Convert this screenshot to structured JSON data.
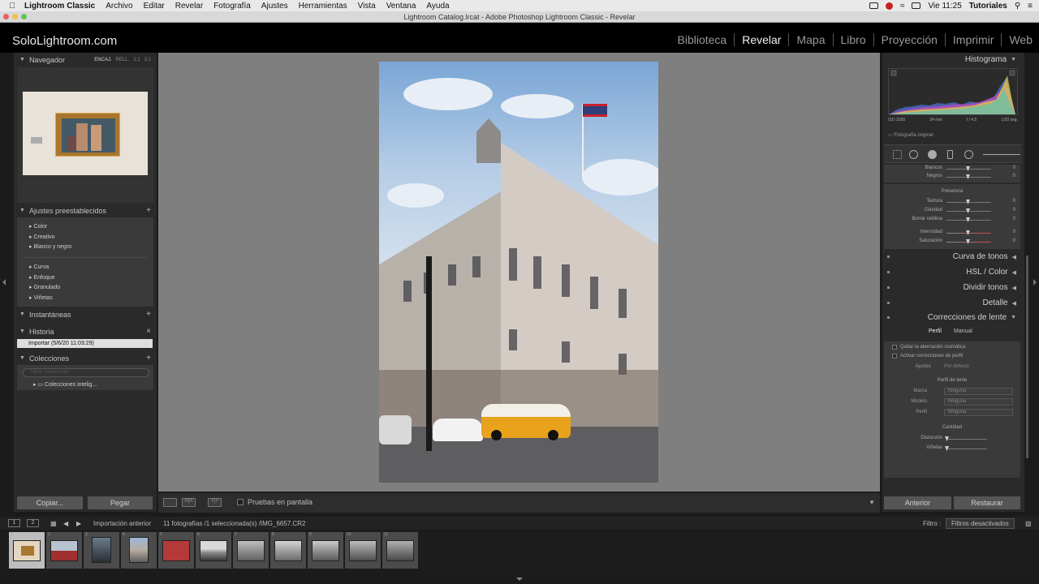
{
  "menubar": {
    "apple": "",
    "app_name": "Lightroom Classic",
    "items": [
      "Archivo",
      "Editar",
      "Revelar",
      "Fotografía",
      "Ajustes",
      "Herramientas",
      "Vista",
      "Ventana",
      "Ayuda"
    ],
    "clock": "Vie 11:25",
    "user": "Tutoriales"
  },
  "window": {
    "title": "Lightroom Catalog.lrcat - Adobe Photoshop Lightroom Classic - Revelar"
  },
  "identity_plate": "SoloLightroom.com",
  "modules": [
    {
      "label": "Biblioteca",
      "active": false
    },
    {
      "label": "Revelar",
      "active": true
    },
    {
      "label": "Mapa",
      "active": false
    },
    {
      "label": "Libro",
      "active": false
    },
    {
      "label": "Proyección",
      "active": false
    },
    {
      "label": "Imprimir",
      "active": false
    },
    {
      "label": "Web",
      "active": false
    }
  ],
  "left": {
    "navigator": {
      "title": "Navegador",
      "opts": [
        "ENCAJ.",
        "RELL.",
        "1:1",
        "3:1"
      ]
    },
    "presets": {
      "title": "Ajustes preestablecidos",
      "group1": [
        "Color",
        "Creativo",
        "Blanco y negro"
      ],
      "group2": [
        "Curva",
        "Enfoque",
        "Granulado",
        "Viñetas"
      ]
    },
    "snapshots": {
      "title": "Instantáneas"
    },
    "history": {
      "title": "Historia",
      "items": [
        "Importar (5/6/20 11:03:29)"
      ]
    },
    "collections": {
      "title": "Colecciones",
      "search_placeholder": "Filtrar colecciones",
      "items": [
        "Colecciones intelig..."
      ]
    },
    "copy_button": "Copiar...",
    "paste_button": "Pegar"
  },
  "toolbar": {
    "softproof_label": "Pruebas en pantalla",
    "view_btns": [
      "",
      "R|R",
      "Y|Y"
    ]
  },
  "right": {
    "histogram": {
      "title": "Histograma",
      "iso": "ISO 3200",
      "focal": "34 mm",
      "aperture": "f / 4,5",
      "shutter": "1/20 seg.",
      "original": "Fotografía original"
    },
    "basic_tone": [
      {
        "label": "Blancos",
        "value": "0"
      },
      {
        "label": "Negros",
        "value": "0"
      }
    ],
    "presence": {
      "title": "Presencia",
      "sliders": [
        {
          "label": "Textura",
          "value": "0"
        },
        {
          "label": "Claridad",
          "value": "0"
        },
        {
          "label": "Borrar neblina",
          "value": "0"
        },
        {
          "label": "Intensidad",
          "value": "0"
        },
        {
          "label": "Saturación",
          "value": "0"
        }
      ]
    },
    "panels": [
      "Curva de tonos",
      "HSL / Color",
      "Dividir tonos",
      "Detalle",
      "Correcciones de lente"
    ],
    "lens": {
      "tabs": [
        "Perfil",
        "Manual"
      ],
      "checks": [
        "Quitar la aberración cromática",
        "Activar correcciones de perfil"
      ],
      "setup_label": "Ajustes",
      "setup_value": "Por defecto",
      "profile_title": "Perfil de lente",
      "fields": [
        {
          "label": "Marca",
          "value": "Ninguna"
        },
        {
          "label": "Modelo",
          "value": "Ninguna"
        },
        {
          "label": "Perfil",
          "value": "Ninguna"
        }
      ],
      "amount_title": "Cantidad",
      "amount_sliders": [
        {
          "label": "Distorsión"
        },
        {
          "label": "Viñetas"
        }
      ]
    },
    "prev_button": "Anterior",
    "reset_button": "Restaurar"
  },
  "filmstrip": {
    "page1": "1",
    "page2": "2",
    "source": "Importación anterior",
    "info": "11 fotografías /1 seleccionada(s) /IMG_6657.CR2",
    "filter_label": "Filtro :",
    "filter_value": "Filtros desactivados",
    "numbers": [
      "1",
      "2",
      "3",
      "4",
      "5",
      "6",
      "7",
      "8",
      "9",
      "10",
      "11"
    ]
  }
}
